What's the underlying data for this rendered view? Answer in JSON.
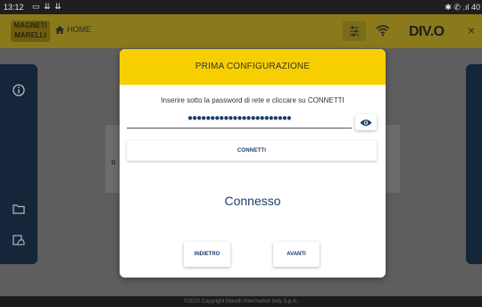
{
  "status_bar": {
    "time": "13:12",
    "icons_left": [
      "image-icon",
      "download-icon",
      "download-icon"
    ],
    "right_text": "✱ ✆ .ıl 40"
  },
  "header": {
    "logo_text_line1": "MAGNETI",
    "logo_text_line2": "MARELLI",
    "home_label": "HOME",
    "brand": "DIV.O",
    "close_glyph": "×"
  },
  "dialog": {
    "title": "PRIMA CONFIGURAZIONE",
    "instructions": "Inserire sotto la password di rete e cliccare su CONNETTI",
    "password_masked": "●●●●●●●●●●●●●●●●●●●●●●●",
    "connect_label": "CONNETTI",
    "status": "Connesso",
    "back_label": "INDIETRO",
    "next_label": "AVANTI"
  },
  "background": {
    "card_label": "D"
  },
  "footer": {
    "copyright": "©2020 Copyright Marelli Aftermarket Italy S.p.A."
  },
  "colors": {
    "header_yellow": "#f7cf00",
    "accent_navy": "#1d3e6b",
    "rail_navy": "#15253a"
  }
}
